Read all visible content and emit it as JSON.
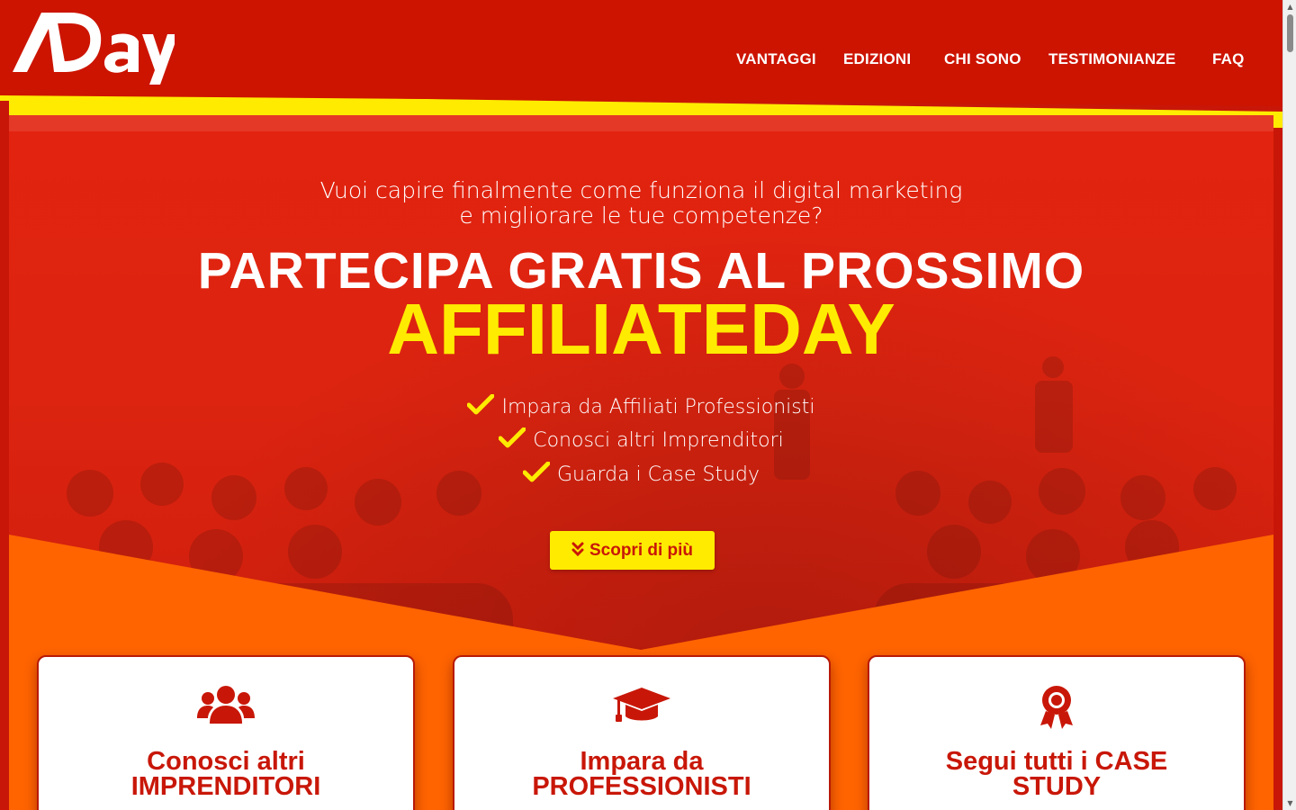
{
  "header": {
    "logo_text": "ADay",
    "nav": [
      {
        "label": "VANTAGGI"
      },
      {
        "label": "EDIZIONI"
      },
      {
        "label": "CHI SONO"
      },
      {
        "label": "TESTIMONIANZE"
      },
      {
        "label": "FAQ"
      }
    ]
  },
  "hero": {
    "subtitle_line1": "Vuoi capire finalmente come funziona il digital marketing",
    "subtitle_line2": "e migliorare le tue competenze?",
    "headline": "PARTECIPA GRATIS AL PROSSIMO",
    "headline_highlight": "AFFILIATEDAY",
    "bullets": [
      {
        "text": "Impara da Affiliati Professionisti"
      },
      {
        "text": "Conosci altri Imprenditori"
      },
      {
        "text": "Guarda i Case Study"
      }
    ],
    "cta_label": "Scopri di più"
  },
  "cards": [
    {
      "icon": "users-icon",
      "title_line1": "Conosci altri",
      "title_line2": "IMPRENDITORI"
    },
    {
      "icon": "graduation-cap-icon",
      "title_line1": "Impara da",
      "title_line2": "PROFESSIONISTI"
    },
    {
      "icon": "award-icon",
      "title_line1": "Segui tutti i CASE",
      "title_line2": "STUDY"
    }
  ],
  "colors": {
    "brand_red": "#cc1400",
    "accent_yellow": "#ffeb00",
    "band_orange": "#ff6400",
    "white": "#ffffff"
  }
}
